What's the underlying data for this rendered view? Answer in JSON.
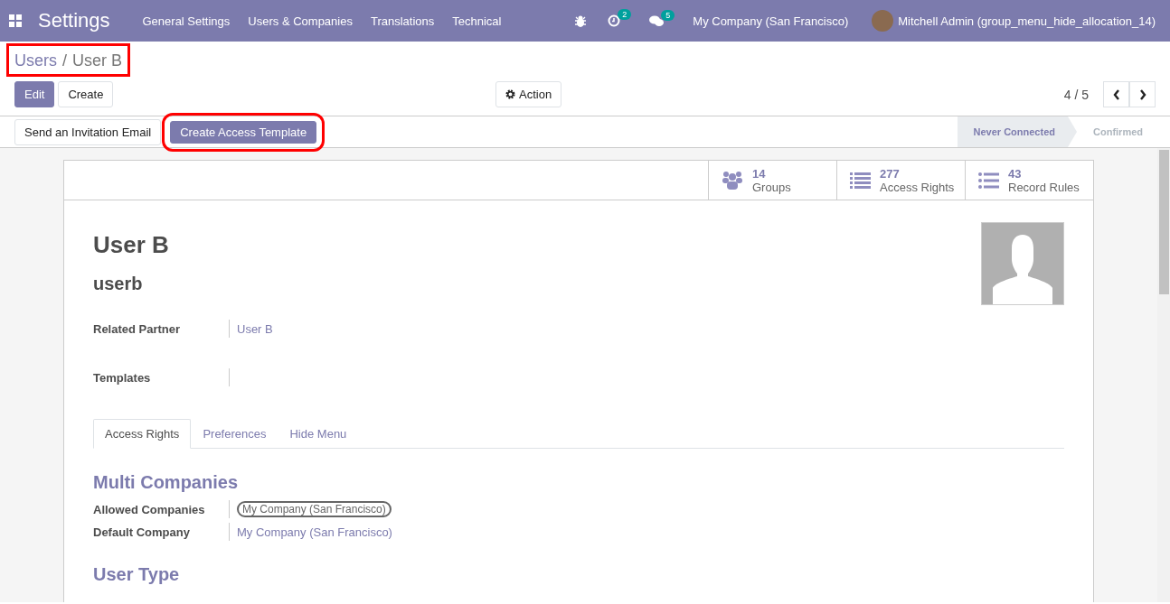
{
  "navbar": {
    "app_title": "Settings",
    "menus": [
      "General Settings",
      "Users & Companies",
      "Translations",
      "Technical"
    ],
    "activity_count": "2",
    "message_count": "5",
    "company": "My Company (San Francisco)",
    "user": "Mitchell Admin (group_menu_hide_allocation_14)"
  },
  "breadcrumb": {
    "items": [
      "Users",
      "User B"
    ],
    "separator": "/",
    "highlighted": true
  },
  "control_buttons": [
    {
      "label": "Edit",
      "kind": "primary"
    },
    {
      "label": "Create",
      "kind": "secondary"
    }
  ],
  "action_button": "Action",
  "pager": "4 / 5",
  "header_buttons": [
    {
      "label": "Send an Invitation Email",
      "kind": "secondary",
      "highlighted": false
    },
    {
      "label": "Create Access Template",
      "kind": "primary",
      "highlighted": true
    }
  ],
  "status_steps": [
    {
      "label": "Never Connected",
      "selected": true
    },
    {
      "label": "Confirmed",
      "selected": false
    }
  ],
  "smart_buttons": [
    {
      "kind": "groups",
      "count": "14",
      "label": "Groups"
    },
    {
      "kind": "list",
      "count": "277",
      "label": "Access Rights"
    },
    {
      "kind": "bullets",
      "count": "43",
      "label": "Record Rules"
    }
  ],
  "record": {
    "name": "User B",
    "login": "userb"
  },
  "fields": [
    {
      "label": "Related Partner",
      "value": "User B",
      "kind": "link"
    },
    {
      "label": "Templates",
      "kind": "empty"
    }
  ],
  "tabs": [
    {
      "label": "Access Rights",
      "selected": true
    },
    {
      "label": "Preferences",
      "selected": false
    },
    {
      "label": "Hide Menu",
      "selected": false
    }
  ],
  "sections": [
    {
      "title": "Multi Companies",
      "fields": [
        {
          "label": "Allowed Companies",
          "value": "My Company (San Francisco)",
          "kind": "tag"
        },
        {
          "label": "Default Company",
          "value": "My Company (San Francisco)",
          "kind": "link"
        }
      ]
    },
    {
      "title": "User Type"
    }
  ]
}
